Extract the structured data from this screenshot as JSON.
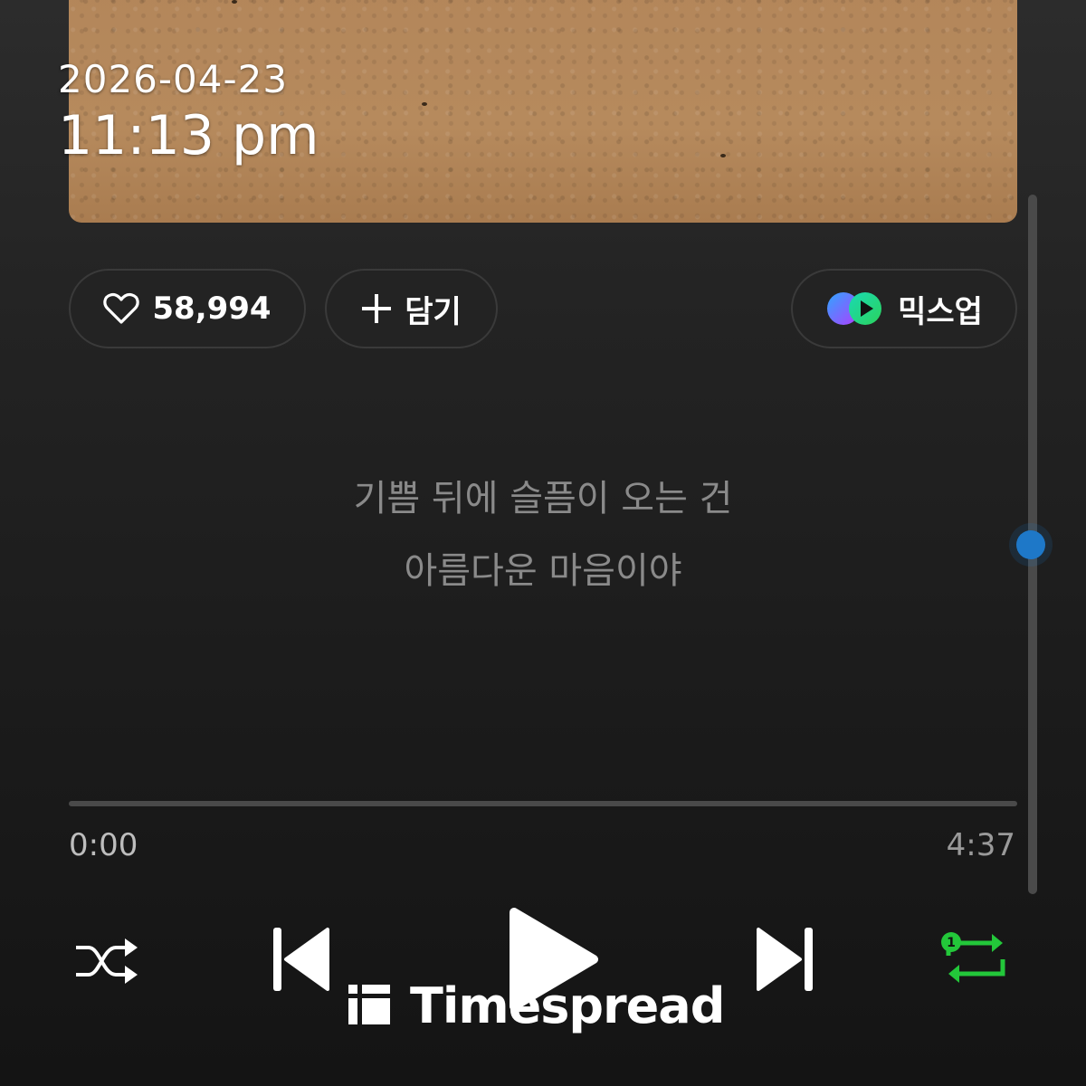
{
  "timestamp": {
    "date": "2026-04-23",
    "time": "11:13 pm"
  },
  "actions": {
    "like_count": "58,994",
    "add_label": "담기",
    "mixup_label": "믹스업"
  },
  "lyrics": {
    "line1": "기쁨 뒤에 슬픔이 오는 건",
    "line2": "아름다운 마음이야"
  },
  "playback": {
    "current_time": "0:00",
    "total_time": "4:37",
    "progress": 0,
    "repeat_badge": "1"
  },
  "colors": {
    "accent_green": "#23c73a",
    "scroll_thumb": "#1e78c8"
  },
  "icons": [
    "heart-icon",
    "plus-icon",
    "mixup-logo-icon",
    "shuffle-icon",
    "previous-icon",
    "play-icon",
    "next-icon",
    "repeat-one-icon"
  ],
  "watermark": {
    "text": "Timespread"
  }
}
